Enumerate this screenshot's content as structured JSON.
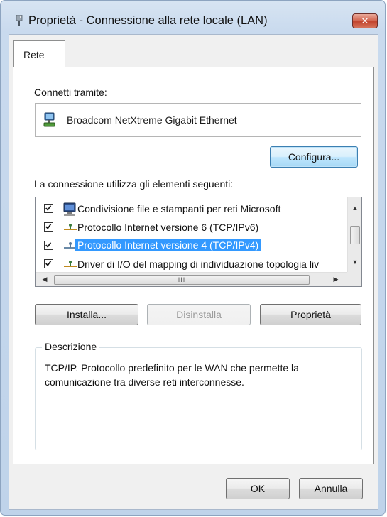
{
  "window": {
    "title": "Proprietà - Connessione alla rete locale (LAN)",
    "close_label": "✕"
  },
  "tabs": [
    {
      "label": "Rete",
      "active": true
    }
  ],
  "connect_via": {
    "label": "Connetti tramite:",
    "adapter": "Broadcom NetXtreme Gigabit Ethernet",
    "configure_button": "Configura..."
  },
  "items": {
    "label": "La connessione utilizza gli elementi seguenti:",
    "list": [
      {
        "label": "Condivisione file e stampanti per reti Microsoft",
        "checked": true,
        "selected": false,
        "icon": "network-computer-icon"
      },
      {
        "label": "Protocollo Internet versione 6 (TCP/IPv6)",
        "checked": true,
        "selected": false,
        "icon": "protocol-icon"
      },
      {
        "label": "Protocollo Internet versione 4 (TCP/IPv4)",
        "checked": true,
        "selected": true,
        "icon": "protocol-icon"
      },
      {
        "label": "Driver di I/O del mapping di individuazione topologia liv",
        "checked": true,
        "selected": false,
        "icon": "protocol-icon"
      }
    ],
    "hscroll_grip": "III"
  },
  "actions": {
    "install": "Installa...",
    "uninstall": "Disinstalla",
    "properties": "Proprietà"
  },
  "description": {
    "title": "Descrizione",
    "text": "TCP/IP. Protocollo predefinito per le WAN che permette la comunicazione tra diverse reti interconnesse."
  },
  "footer": {
    "ok": "OK",
    "cancel": "Annulla"
  },
  "colors": {
    "selection": "#3399ff",
    "close_button": "#c2432c",
    "focus_button": "#bee6fd"
  }
}
